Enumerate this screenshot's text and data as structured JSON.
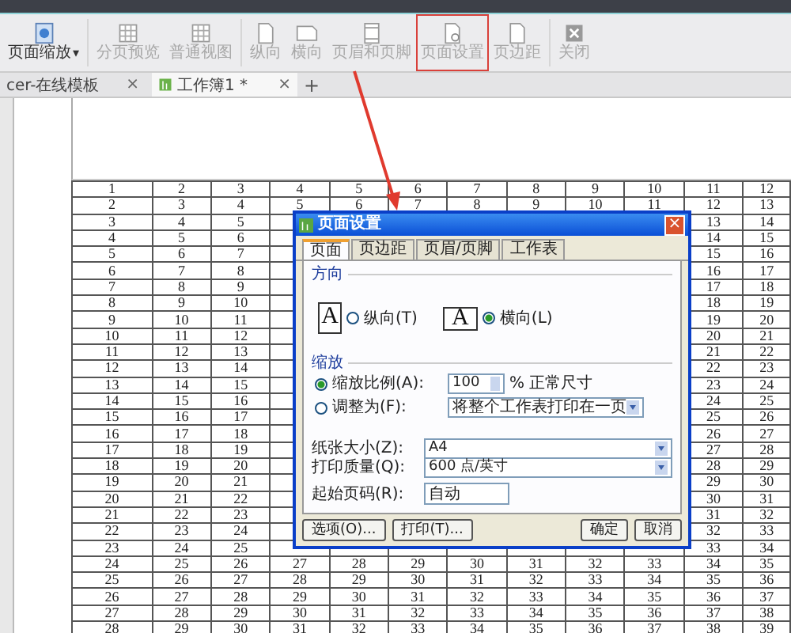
{
  "toolbar": [
    {
      "label": "页面缩放",
      "kind": "zoom",
      "caret": "▾",
      "disabled": false,
      "highlighted": false
    },
    {
      "label": "分页预览",
      "kind": "grid",
      "disabled": true,
      "highlighted": false
    },
    {
      "label": "普通视图",
      "kind": "grid",
      "disabled": true,
      "highlighted": false
    },
    {
      "label": "纵向",
      "kind": "portrait",
      "disabled": true,
      "highlighted": false
    },
    {
      "label": "横向",
      "kind": "landscape",
      "disabled": true,
      "highlighted": false
    },
    {
      "label": "页眉和页脚",
      "kind": "header",
      "disabled": true,
      "highlighted": false
    },
    {
      "label": "页面设置",
      "kind": "setup",
      "disabled": true,
      "highlighted": true
    },
    {
      "label": "页边距",
      "kind": "portrait",
      "disabled": true,
      "highlighted": false
    },
    {
      "label": "关闭",
      "kind": "close",
      "disabled": true,
      "highlighted": false
    }
  ],
  "doc_tabs": [
    {
      "label": "cer-在线模板",
      "close": "×",
      "selected": false
    },
    {
      "label": "工作簿1 *",
      "close": "×",
      "selected": true
    }
  ],
  "new_tab": "+",
  "sheet": {
    "rows": [
      [
        "1",
        "2",
        "3",
        "4",
        "5",
        "6",
        "7",
        "8",
        "9",
        "10",
        "11",
        "12"
      ],
      [
        "2",
        "3",
        "4",
        "5",
        "6",
        "7",
        "8",
        "9",
        "10",
        "11",
        "12",
        "13"
      ],
      [
        "3",
        "4",
        "5",
        null,
        null,
        null,
        null,
        null,
        null,
        null,
        "13",
        "14"
      ],
      [
        "4",
        "5",
        "6",
        null,
        null,
        null,
        null,
        null,
        null,
        null,
        "14",
        "15"
      ],
      [
        "5",
        "6",
        "7",
        null,
        null,
        null,
        null,
        null,
        null,
        null,
        "15",
        "16"
      ],
      [
        "6",
        "7",
        "8",
        null,
        null,
        null,
        null,
        null,
        null,
        null,
        "16",
        "17"
      ],
      [
        "7",
        "8",
        "9",
        null,
        null,
        null,
        null,
        null,
        null,
        null,
        "17",
        "18"
      ],
      [
        "8",
        "9",
        "10",
        null,
        null,
        null,
        null,
        null,
        null,
        null,
        "18",
        "19"
      ],
      [
        "9",
        "10",
        "11",
        null,
        null,
        null,
        null,
        null,
        null,
        null,
        "19",
        "20"
      ],
      [
        "10",
        "11",
        "12",
        null,
        null,
        null,
        null,
        null,
        null,
        null,
        "20",
        "21"
      ],
      [
        "11",
        "12",
        "13",
        null,
        null,
        null,
        null,
        null,
        null,
        null,
        "21",
        "22"
      ],
      [
        "12",
        "13",
        "14",
        null,
        null,
        null,
        null,
        null,
        null,
        null,
        "22",
        "23"
      ],
      [
        "13",
        "14",
        "15",
        null,
        null,
        null,
        null,
        null,
        null,
        null,
        "23",
        "24"
      ],
      [
        "14",
        "15",
        "16",
        null,
        null,
        null,
        null,
        null,
        null,
        null,
        "24",
        "25"
      ],
      [
        "15",
        "16",
        "17",
        null,
        null,
        null,
        null,
        null,
        null,
        null,
        "25",
        "26"
      ],
      [
        "16",
        "17",
        "18",
        null,
        null,
        null,
        null,
        null,
        null,
        null,
        "26",
        "27"
      ],
      [
        "17",
        "18",
        "19",
        null,
        null,
        null,
        null,
        null,
        null,
        null,
        "27",
        "28"
      ],
      [
        "18",
        "19",
        "20",
        null,
        null,
        null,
        null,
        null,
        null,
        null,
        "28",
        "29"
      ],
      [
        "19",
        "20",
        "21",
        null,
        null,
        null,
        null,
        null,
        null,
        null,
        "29",
        "30"
      ],
      [
        "20",
        "21",
        "22",
        null,
        null,
        null,
        null,
        null,
        null,
        null,
        "30",
        "31"
      ],
      [
        "21",
        "22",
        "23",
        null,
        null,
        null,
        null,
        null,
        null,
        null,
        "31",
        "32"
      ],
      [
        "22",
        "23",
        "24",
        null,
        null,
        null,
        null,
        null,
        null,
        null,
        "32",
        "33"
      ],
      [
        "23",
        "24",
        "25",
        null,
        null,
        null,
        null,
        null,
        null,
        null,
        "33",
        "34"
      ],
      [
        "24",
        "25",
        "26",
        "27",
        "28",
        "29",
        "30",
        "31",
        "32",
        "33",
        "34",
        "35"
      ],
      [
        "25",
        "26",
        "27",
        "28",
        "29",
        "30",
        "31",
        "32",
        "33",
        "34",
        "35",
        "36"
      ],
      [
        "26",
        "27",
        "28",
        "29",
        "30",
        "31",
        "32",
        "33",
        "34",
        "35",
        "36",
        "37"
      ],
      [
        "27",
        "28",
        "29",
        "30",
        "31",
        "32",
        "33",
        "34",
        "35",
        "36",
        "37",
        "38"
      ],
      [
        "28",
        "29",
        "30",
        "31",
        "32",
        "33",
        "34",
        "35",
        "36",
        "37",
        "38",
        "39"
      ]
    ]
  },
  "dialog": {
    "title": "页面设置",
    "close": "×",
    "tabs": [
      {
        "label": "页面",
        "selected": true
      },
      {
        "label": "页边距",
        "selected": false
      },
      {
        "label": "页眉/页脚",
        "selected": false
      },
      {
        "label": "工作表",
        "selected": false
      }
    ],
    "orientation": {
      "heading": "方向",
      "options": [
        {
          "kind": "portrait",
          "glyph": "A",
          "label": "纵向(T)",
          "selected": false
        },
        {
          "kind": "landscape",
          "glyph": "A",
          "label": "横向(L)",
          "selected": true
        }
      ]
    },
    "scaling": {
      "heading": "缩放",
      "options": [
        {
          "kind": "spinner",
          "label": "缩放比例(A):",
          "value": "100",
          "suffix": "% 正常尺寸",
          "selected": true
        },
        {
          "kind": "dropdown",
          "label": "调整为(F):",
          "value": "将整个工作表打印在一页",
          "selected": false
        }
      ]
    },
    "fields": [
      {
        "kind": "dropdown",
        "label": "纸张大小(Z):",
        "value": "A4"
      },
      {
        "kind": "dropdown",
        "label": "打印质量(Q):",
        "value": "600 点/英寸"
      },
      {
        "kind": "text",
        "label": "起始页码(R):",
        "value": "自动"
      }
    ],
    "buttons": [
      {
        "label": "选项(O)...",
        "kind": "left"
      },
      {
        "label": "打印(T)...",
        "kind": "left"
      },
      {
        "label": "确定",
        "kind": "right"
      },
      {
        "label": "取消",
        "kind": "right"
      }
    ]
  }
}
